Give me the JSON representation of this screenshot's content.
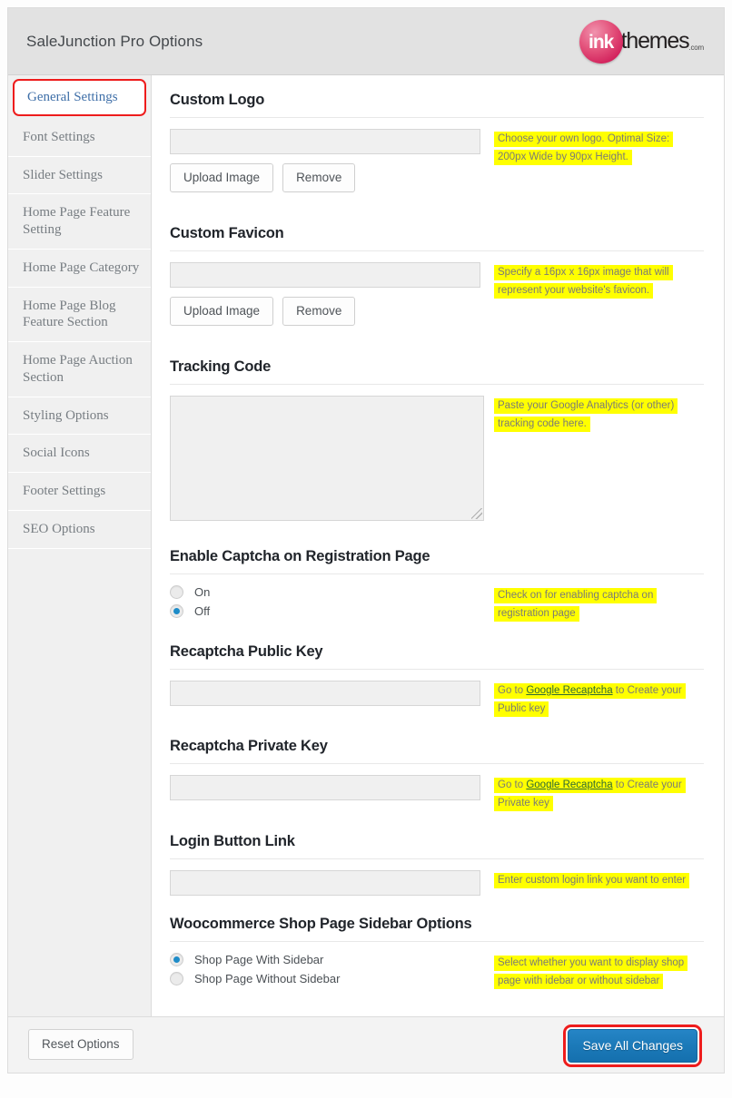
{
  "header": {
    "title": "SaleJunction Pro Options",
    "logo": {
      "mark": "ink",
      "word": "themes",
      "suffix": ".com"
    }
  },
  "sidebar": {
    "items": [
      {
        "label": "General Settings",
        "active": true
      },
      {
        "label": "Font Settings",
        "active": false
      },
      {
        "label": "Slider Settings",
        "active": false
      },
      {
        "label": "Home Page Feature Setting",
        "active": false
      },
      {
        "label": "Home Page Category",
        "active": false
      },
      {
        "label": "Home Page Blog Feature Section",
        "active": false
      },
      {
        "label": "Home Page Auction Section",
        "active": false
      },
      {
        "label": "Styling Options",
        "active": false
      },
      {
        "label": "Social Icons",
        "active": false
      },
      {
        "label": "Footer Settings",
        "active": false
      },
      {
        "label": "SEO Options",
        "active": false
      }
    ]
  },
  "buttons": {
    "upload_image": "Upload Image",
    "remove": "Remove",
    "reset_options": "Reset Options",
    "save_all_changes": "Save All Changes"
  },
  "sections": {
    "custom_logo": {
      "title": "Custom Logo",
      "value": "",
      "help": "Choose your own logo. Optimal Size: 200px Wide by 90px Height."
    },
    "custom_favicon": {
      "title": "Custom Favicon",
      "value": "",
      "help": "Specify a 16px x 16px image that will represent your website's favicon."
    },
    "tracking_code": {
      "title": "Tracking Code",
      "value": "",
      "help": "Paste your Google Analytics (or other) tracking code here."
    },
    "captcha": {
      "title": "Enable Captcha on Registration Page",
      "help": "Check on for enabling captcha on registration page",
      "options": [
        {
          "label": "On",
          "selected": false
        },
        {
          "label": "Off",
          "selected": true
        }
      ]
    },
    "recaptcha_public": {
      "title": "Recaptcha Public Key",
      "value": "",
      "help_before": "Go to ",
      "help_link": "Google Recaptcha",
      "help_after": " to Create your Public key"
    },
    "recaptcha_private": {
      "title": "Recaptcha Private Key",
      "value": "",
      "help_before": "Go to ",
      "help_link": "Google Recaptcha",
      "help_after": " to Create your Private key"
    },
    "login_button_link": {
      "title": "Login Button Link",
      "value": "",
      "help": "Enter custom login link you want to enter"
    },
    "shop_sidebar": {
      "title": "Woocommerce Shop Page Sidebar Options",
      "help": "Select whether you want to display shop page with idebar or without sidebar",
      "options": [
        {
          "label": "Shop Page With Sidebar",
          "selected": true
        },
        {
          "label": "Shop Page Without Sidebar",
          "selected": false
        }
      ]
    }
  },
  "colors": {
    "accent_red": "#ee1c1c",
    "save_blue": "#1b79b8",
    "tip_yellow": "#ffff00",
    "active_nav_text": "#3f6fa8"
  }
}
